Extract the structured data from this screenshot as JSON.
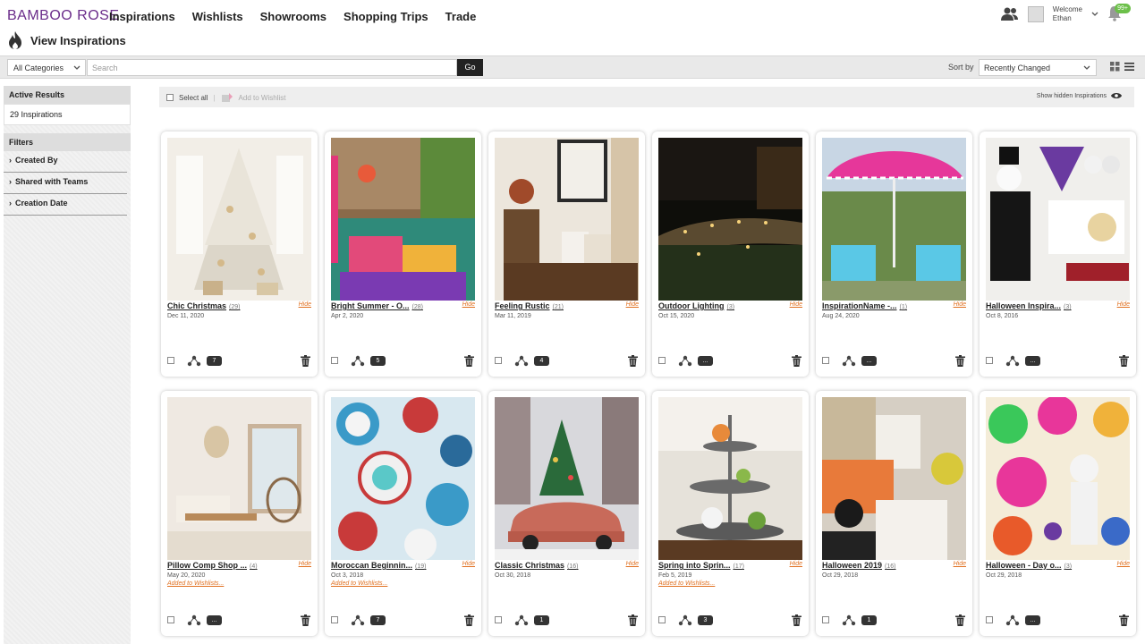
{
  "brand": {
    "logo": "BAMBOO ROSE"
  },
  "nav": [
    "Inspirations",
    "Wishlists",
    "Showrooms",
    "Shopping Trips",
    "Trade"
  ],
  "page_title": "View Inspirations",
  "user": {
    "welcome": "Welcome",
    "name": "Ethan",
    "notifications": "99+"
  },
  "search": {
    "category": "All Categories",
    "placeholder": "Search",
    "go": "Go",
    "sort_label": "Sort by",
    "sort_value": "Recently Changed"
  },
  "sidebar": {
    "active_results_title": "Active Results",
    "active_results_value": "29 Inspirations",
    "filters_title": "Filters",
    "filters": [
      "Created By",
      "Shared with Teams",
      "Creation Date"
    ]
  },
  "actions": {
    "select_all": "Select all",
    "add_to_wishlist": "Add to Wishlist",
    "show_hidden": "Show hidden Inspirations"
  },
  "cards": [
    {
      "title": "Chic Christmas",
      "count": "(29)",
      "date": "Dec 11, 2020",
      "wishlist": "",
      "comments": "7",
      "hide": "Hide"
    },
    {
      "title": "Bright Summer - O...",
      "count": "(28)",
      "date": "Apr 2, 2020",
      "wishlist": "",
      "comments": "5",
      "hide": "Hide"
    },
    {
      "title": "Feeling Rustic",
      "count": "(21)",
      "date": "Mar 11, 2019",
      "wishlist": "",
      "comments": "4",
      "hide": "Hide"
    },
    {
      "title": "Outdoor Lighting",
      "count": "(3)",
      "date": "Oct 15, 2020",
      "wishlist": "",
      "comments": "...",
      "hide": "Hide"
    },
    {
      "title": "InspirationName -...",
      "count": "(1)",
      "date": "Aug 24, 2020",
      "wishlist": "",
      "comments": "...",
      "hide": "Hide"
    },
    {
      "title": "Halloween Inspira...",
      "count": "(3)",
      "date": "Oct 8, 2016",
      "wishlist": "",
      "comments": "...",
      "hide": "Hide"
    },
    {
      "title": "Pillow Comp Shop ...",
      "count": "(4)",
      "date": "May 20, 2020",
      "wishlist": "Added to Wishlists...",
      "comments": "...",
      "hide": "Hide"
    },
    {
      "title": "Moroccan Beginnin...",
      "count": "(19)",
      "date": "Oct 3, 2018",
      "wishlist": "Added to Wishlists...",
      "comments": "7",
      "hide": "Hide"
    },
    {
      "title": "Classic Christmas",
      "count": "(16)",
      "date": "Oct 30, 2018",
      "wishlist": "",
      "comments": "1",
      "hide": "Hide"
    },
    {
      "title": "Spring into Sprin...",
      "count": "(17)",
      "date": "Feb 5, 2019",
      "wishlist": "Added to Wishlists...",
      "comments": "3",
      "hide": "Hide"
    },
    {
      "title": "Halloween 2019",
      "count": "(16)",
      "date": "Oct 29, 2018",
      "wishlist": "",
      "comments": "1",
      "hide": "Hide"
    },
    {
      "title": "Halloween - Day o...",
      "count": "(3)",
      "date": "Oct 29, 2018",
      "wishlist": "",
      "comments": "...",
      "hide": "Hide"
    }
  ],
  "colors": {
    "brand": "#6a2c8a",
    "hide_link": "#e07020",
    "notification": "#6cc04a"
  }
}
